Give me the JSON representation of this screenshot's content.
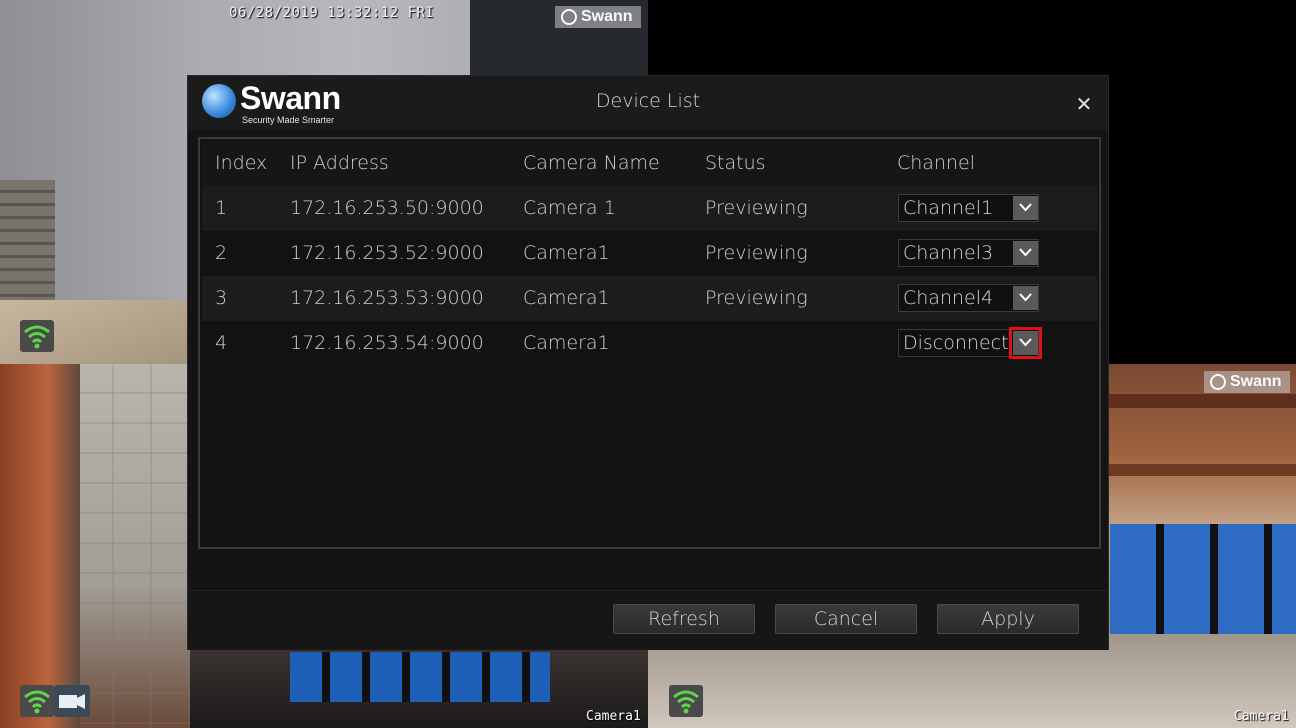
{
  "osd": {
    "datetime": "06/28/2019 13:32:12 FRI",
    "watermark": "Swann",
    "cam_label_3": "Camera1",
    "cam_label_4": "Camera1"
  },
  "dialog": {
    "logo_text": "Swann",
    "logo_tagline": "Security Made Smarter",
    "title": "Device List",
    "close_glyph": "✕",
    "columns": {
      "index": "Index",
      "ip": "IP Address",
      "name": "Camera Name",
      "status": "Status",
      "channel": "Channel"
    },
    "rows": [
      {
        "index": "1",
        "ip": "172.16.253.50:9000",
        "name": "Camera 1",
        "status": "Previewing",
        "channel": "Channel1"
      },
      {
        "index": "2",
        "ip": "172.16.253.52:9000",
        "name": "Camera1",
        "status": "Previewing",
        "channel": "Channel3"
      },
      {
        "index": "3",
        "ip": "172.16.253.53:9000",
        "name": "Camera1",
        "status": "Previewing",
        "channel": "Channel4"
      },
      {
        "index": "4",
        "ip": "172.16.253.54:9000",
        "name": "Camera1",
        "status": "",
        "channel": "Disconnect"
      }
    ],
    "buttons": {
      "refresh": "Refresh",
      "cancel": "Cancel",
      "apply": "Apply"
    }
  },
  "colors": {
    "highlight": "#e0101a",
    "wifi": "#5ed64a"
  }
}
